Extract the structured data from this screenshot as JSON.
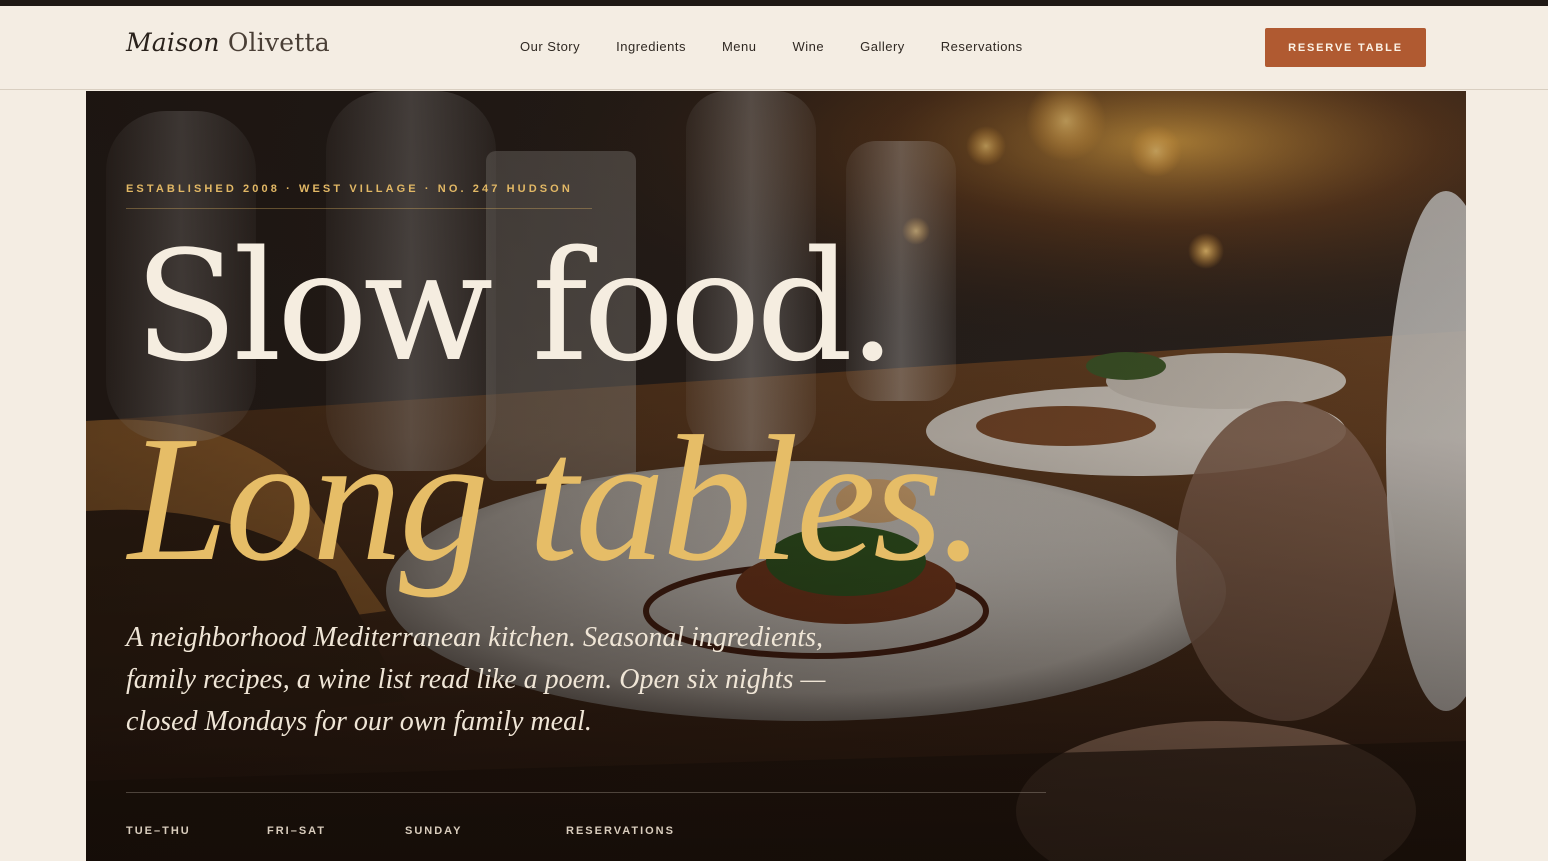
{
  "brand": {
    "name_italic": "Maison",
    "name_plain": "Olivetta"
  },
  "nav": {
    "links": [
      "Our Story",
      "Ingredients",
      "Menu",
      "Wine",
      "Gallery",
      "Reservations"
    ],
    "cta": "RESERVE TABLE"
  },
  "hero": {
    "eyebrow": "ESTABLISHED 2008 · WEST VILLAGE · NO. 247 HUDSON",
    "headline_line1": "Slow food.",
    "headline_line2": "Long tables.",
    "lede": "A neighborhood Mediterranean kitchen. Seasonal ingredients, family recipes, a wine list read like a poem. Open six nights — closed Mondays for our own family meal.",
    "hours": [
      {
        "label": "TUE–THU",
        "value": ""
      },
      {
        "label": "FRI–SAT",
        "value": ""
      },
      {
        "label": "SUNDAY",
        "value": ""
      },
      {
        "label": "RESERVATIONS",
        "value": ""
      }
    ]
  },
  "colors": {
    "background": "#f4ede3",
    "accent": "#b05a31",
    "gold": "#e6bd67",
    "ink": "#2a221c"
  }
}
